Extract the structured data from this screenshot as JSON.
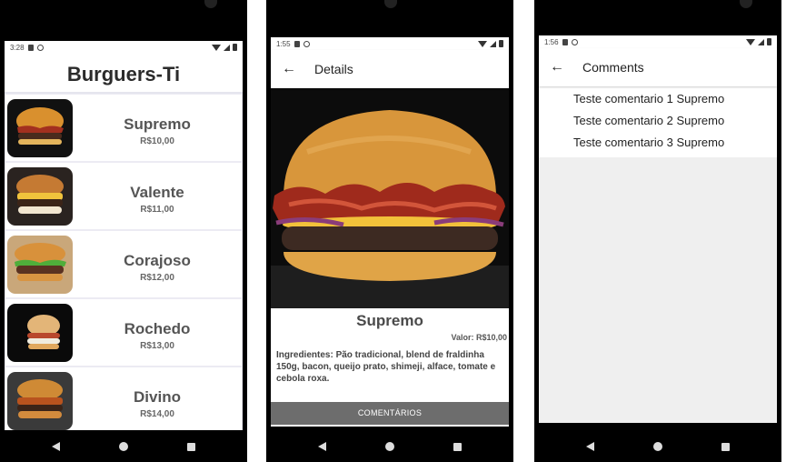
{
  "screens": {
    "list": {
      "status_time": "3:28",
      "title": "Burguers-Ti",
      "items": [
        {
          "name": "Supremo",
          "price": "R$10,00"
        },
        {
          "name": "Valente",
          "price": "R$11,00"
        },
        {
          "name": "Corajoso",
          "price": "R$12,00"
        },
        {
          "name": "Rochedo",
          "price": "R$13,00"
        },
        {
          "name": "Divino",
          "price": "R$14,00"
        }
      ]
    },
    "details": {
      "status_time": "1:55",
      "appbar_title": "Details",
      "name": "Supremo",
      "price": "Valor: R$10,00",
      "ingredients": "Ingredientes: Pão tradicional, blend  de fraldinha 150g, bacon, queijo prato, shimeji, alface, tomate e cebola roxa.",
      "comments_button": "COMENTÁRIOS"
    },
    "comments": {
      "status_time": "1:56",
      "appbar_title": "Comments",
      "items": [
        "Teste comentario 1 Supremo",
        "Teste comentario 2 Supremo",
        "Teste comentario 3 Supremo"
      ]
    }
  },
  "icons": {
    "back": "arrow-left-icon",
    "nav": [
      "nav-back-icon",
      "nav-home-icon",
      "nav-recents-icon"
    ]
  },
  "colors": {
    "list_background": "#ecebf3",
    "button_gray": "#6d6d6d",
    "phone_frame": "#000000"
  }
}
